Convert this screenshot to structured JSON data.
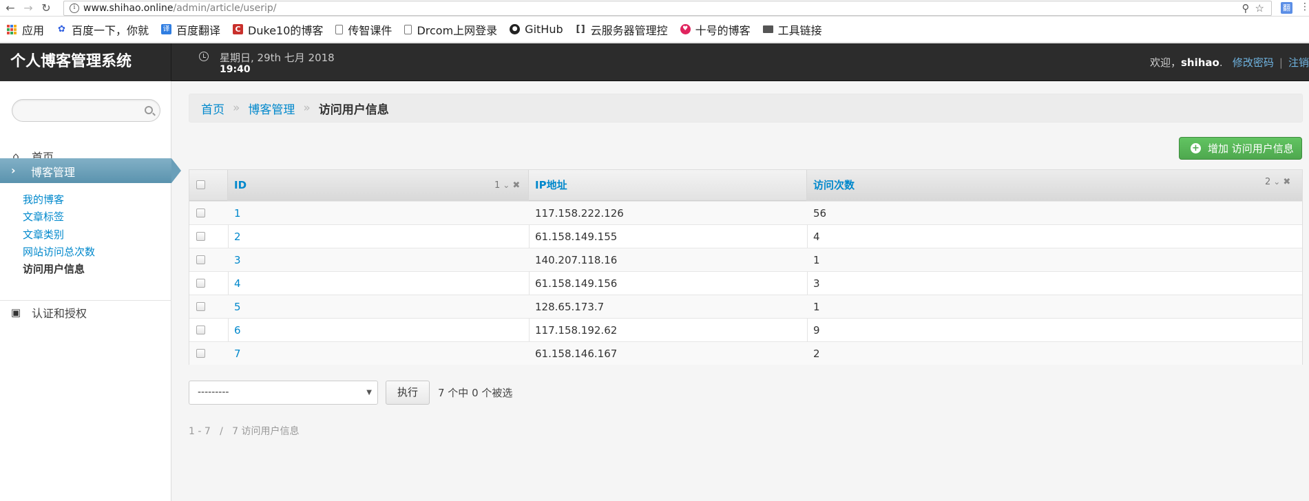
{
  "browser": {
    "url_host": "www.shihao.online",
    "url_path": "/admin/article/userip/",
    "bookmarks": [
      {
        "label": "应用",
        "icon": "apps-grid-icon"
      },
      {
        "label": "百度一下，你就",
        "icon": "baidu-paw-icon"
      },
      {
        "label": "百度翻译",
        "icon": "translate-icon"
      },
      {
        "label": "Duke10的博客",
        "icon": "csdn-icon"
      },
      {
        "label": "传智课件",
        "icon": "page-icon"
      },
      {
        "label": "Drcom上网登录",
        "icon": "page-icon"
      },
      {
        "label": "GitHub",
        "icon": "github-icon"
      },
      {
        "label": "云服务器管理控",
        "icon": "cloud-icon"
      },
      {
        "label": "十号的博客",
        "icon": "heart-icon"
      },
      {
        "label": "工具链接",
        "icon": "folder-icon"
      }
    ],
    "ext_badge": "翻"
  },
  "header": {
    "brand": "个人博客管理系统",
    "date_line": "星期日, 29th 七月 2018",
    "time_line": "19:40",
    "welcome": "欢迎，",
    "username": "shihao",
    "change_password": "修改密码",
    "divider": "|",
    "logout": "注销"
  },
  "sidebar": {
    "home": "首页",
    "blog_admin": "博客管理",
    "sub_items": [
      "我的博客",
      "文章标签",
      "文章类别",
      "网站访问总次数",
      "访问用户信息"
    ],
    "auth": "认证和授权"
  },
  "breadcrumb": {
    "home": "首页",
    "section": "博客管理",
    "current": "访问用户信息",
    "divider": "»"
  },
  "add_button": "增加 访问用户信息",
  "table": {
    "columns": [
      "ID",
      "IP地址",
      "访问次数"
    ],
    "id_sort_priority": "1",
    "count_sort_priority": "2",
    "rows": [
      {
        "id": "1",
        "ip": "117.158.222.126",
        "count": "56"
      },
      {
        "id": "2",
        "ip": "61.158.149.155",
        "count": "4"
      },
      {
        "id": "3",
        "ip": "140.207.118.16",
        "count": "1"
      },
      {
        "id": "4",
        "ip": "61.158.149.156",
        "count": "3"
      },
      {
        "id": "5",
        "ip": "128.65.173.7",
        "count": "1"
      },
      {
        "id": "6",
        "ip": "117.158.192.62",
        "count": "9"
      },
      {
        "id": "7",
        "ip": "61.158.146.167",
        "count": "2"
      }
    ]
  },
  "actions": {
    "select_value": "---------",
    "go_button": "执行",
    "selection_counter": "7 个中 0 个被选"
  },
  "pagination": "1 - 7   /   7 访问用户信息",
  "colors": {
    "header_bg": "#2c2c2c",
    "active_nav": "#6a9fb9",
    "link": "#0088cc",
    "add_button": "#5cb85c"
  }
}
